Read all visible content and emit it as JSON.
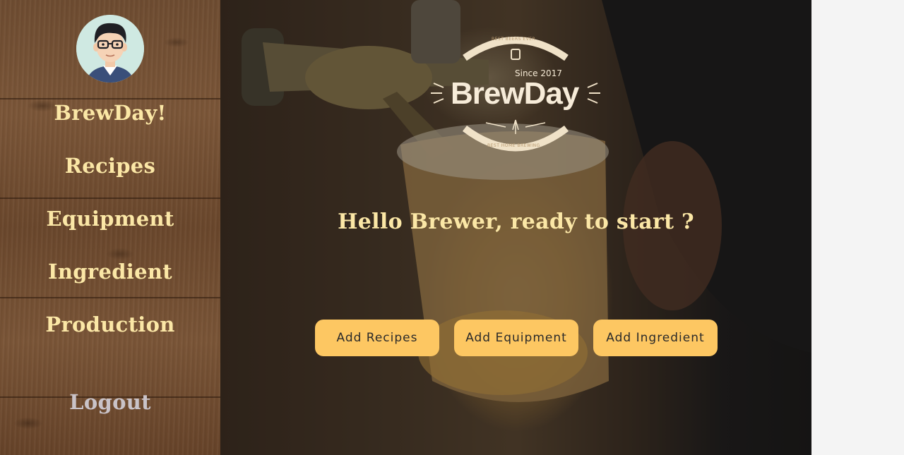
{
  "sidebar": {
    "avatar_alt": "",
    "items": [
      {
        "label": "BrewDay!"
      },
      {
        "label": "Recipes"
      },
      {
        "label": "Equipment"
      },
      {
        "label": "Ingredient"
      },
      {
        "label": "Production"
      }
    ],
    "logout_label": "Logout"
  },
  "logo": {
    "top_text": "BEST BEERS EVER",
    "since": "Since 2017",
    "name": "BrewDay",
    "bottom_text": "BEST HOME BREWING"
  },
  "main": {
    "greeting": "Hello Brewer, ready to start ?",
    "buttons": [
      {
        "label": "Add Recipes"
      },
      {
        "label": "Add Equipment"
      },
      {
        "label": "Add Ingredient"
      }
    ]
  },
  "colors": {
    "nav_text": "#fbe7a6",
    "logout_text": "#c9c3c8",
    "button_bg": "#fdc762",
    "button_text": "#2a2a2a"
  }
}
